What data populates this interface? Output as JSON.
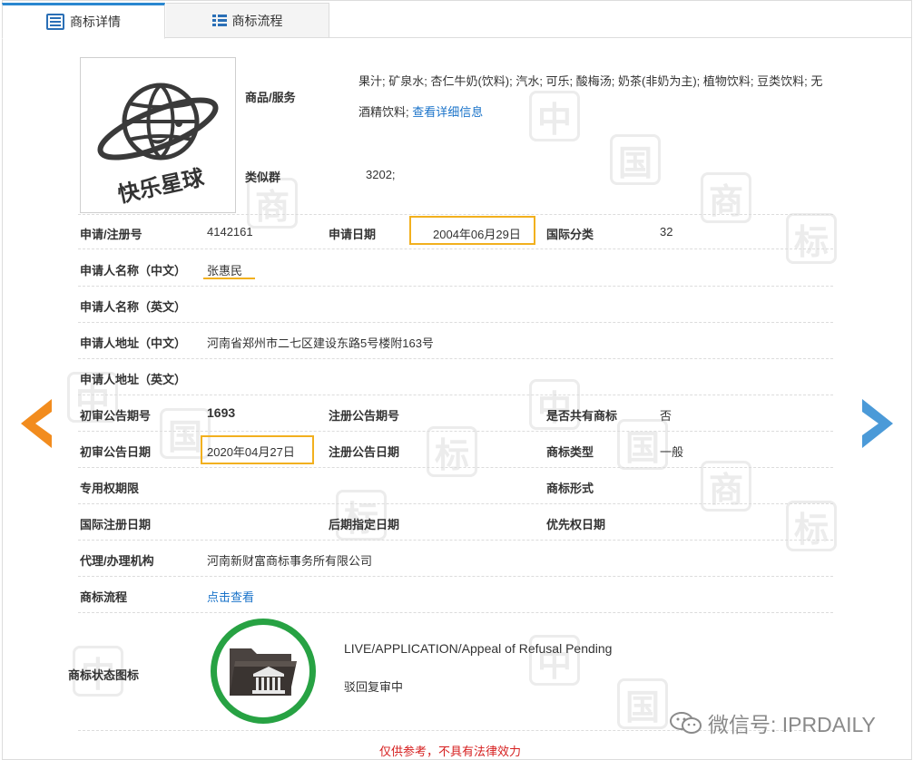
{
  "tabs": [
    {
      "label": "商标详情",
      "active": true,
      "icon": "document-icon"
    },
    {
      "label": "商标流程",
      "active": false,
      "icon": "list-icon"
    }
  ],
  "logo": {
    "text": "快乐星球"
  },
  "goods": {
    "label": "商品/服务",
    "text": "果汁; 矿泉水; 杏仁牛奶(饮料); 汽水; 可乐; 酸梅汤; 奶茶(非奶为主); 植物饮料; 豆类饮料; 无酒精饮料;",
    "link": "查看详细信息"
  },
  "similar_group": {
    "label": "类似群",
    "value": "3202;"
  },
  "fields": {
    "reg_no": {
      "label": "申请/注册号",
      "value": "4142161"
    },
    "app_date": {
      "label": "申请日期",
      "value": "2004年06月29日"
    },
    "intl_class": {
      "label": "国际分类",
      "value": "32"
    },
    "applicant_cn": {
      "label": "申请人名称（中文）",
      "value": "张惠民"
    },
    "applicant_en": {
      "label": "申请人名称（英文）",
      "value": ""
    },
    "address_cn": {
      "label": "申请人地址（中文）",
      "value": "河南省郑州市二七区建设东路5号楼附163号"
    },
    "address_en": {
      "label": "申请人地址（英文）",
      "value": ""
    },
    "prelim_no": {
      "label": "初审公告期号",
      "value": "1693"
    },
    "reg_pub_no": {
      "label": "注册公告期号",
      "value": ""
    },
    "shared": {
      "label": "是否共有商标",
      "value": "否"
    },
    "prelim_date": {
      "label": "初审公告日期",
      "value": "2020年04月27日"
    },
    "reg_pub_date": {
      "label": "注册公告日期",
      "value": ""
    },
    "tm_type": {
      "label": "商标类型",
      "value": "一般"
    },
    "exclusive_period": {
      "label": "专用权期限",
      "value": ""
    },
    "tm_form": {
      "label": "商标形式",
      "value": ""
    },
    "intl_reg_date": {
      "label": "国际注册日期",
      "value": ""
    },
    "later_date": {
      "label": "后期指定日期",
      "value": ""
    },
    "priority_date": {
      "label": "优先权日期",
      "value": ""
    },
    "agent": {
      "label": "代理/办理机构",
      "value": "河南新财富商标事务所有限公司"
    },
    "flow": {
      "label": "商标流程",
      "value": "点击查看"
    },
    "status_icon": {
      "label": "商标状态图标"
    }
  },
  "status": {
    "en": "LIVE/APPLICATION/Appeal of Refusal Pending",
    "cn": "驳回复审中"
  },
  "disclaimer": "仅供参考，不具有法律效力",
  "watermark": {
    "chars": [
      "中",
      "国",
      "商",
      "标"
    ]
  },
  "wechat": {
    "text": "微信号: IPRDAILY"
  },
  "colors": {
    "accent": "#2a87d0",
    "highlight": "#f2b01e",
    "status_green": "#27a243",
    "nav_left": "#f28c1e",
    "nav_right": "#4b9ad8",
    "disclaimer": "#d61f1f"
  }
}
